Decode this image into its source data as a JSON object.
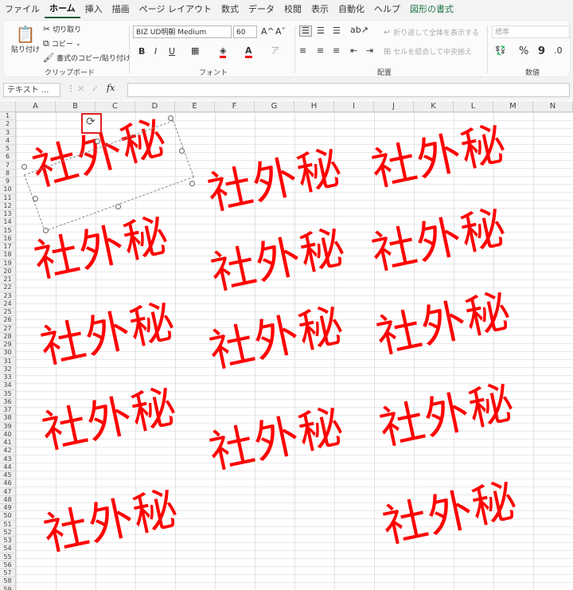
{
  "menu": [
    "ファイル",
    "ホーム",
    "挿入",
    "描画",
    "ページ レイアウト",
    "数式",
    "データ",
    "校閲",
    "表示",
    "自動化",
    "ヘルプ",
    "図形の書式"
  ],
  "menu_active": 1,
  "clipboard": {
    "paste": "貼り付け",
    "cut": "切り取り",
    "copy": "コピー",
    "format_painter": "書式のコピー/貼り付け",
    "label": "クリップボード"
  },
  "font": {
    "name": "BIZ UD明朝 Medium",
    "size": "60",
    "bold": "B",
    "italic": "I",
    "underline": "U",
    "grow": "A^",
    "shrink": "Aˇ",
    "label": "フォント"
  },
  "alignment": {
    "wrap": "折り返して全体を表示する",
    "merge": "セルを結合して中央揃え",
    "label": "配置"
  },
  "number": {
    "format": "標準",
    "percent": "%",
    "comma": "9",
    "label": "数値"
  },
  "formula_bar": {
    "name_box": "テキスト ...",
    "fx": "fx"
  },
  "columns": [
    "A",
    "B",
    "C",
    "D",
    "E",
    "F",
    "G",
    "H",
    "I",
    "J",
    "K",
    "L",
    "M",
    "N"
  ],
  "stamp_text": "社外秘",
  "colors": {
    "stamp": "#ff0000",
    "accent": "#1a5c35",
    "rotate_highlight": "#e02020"
  }
}
